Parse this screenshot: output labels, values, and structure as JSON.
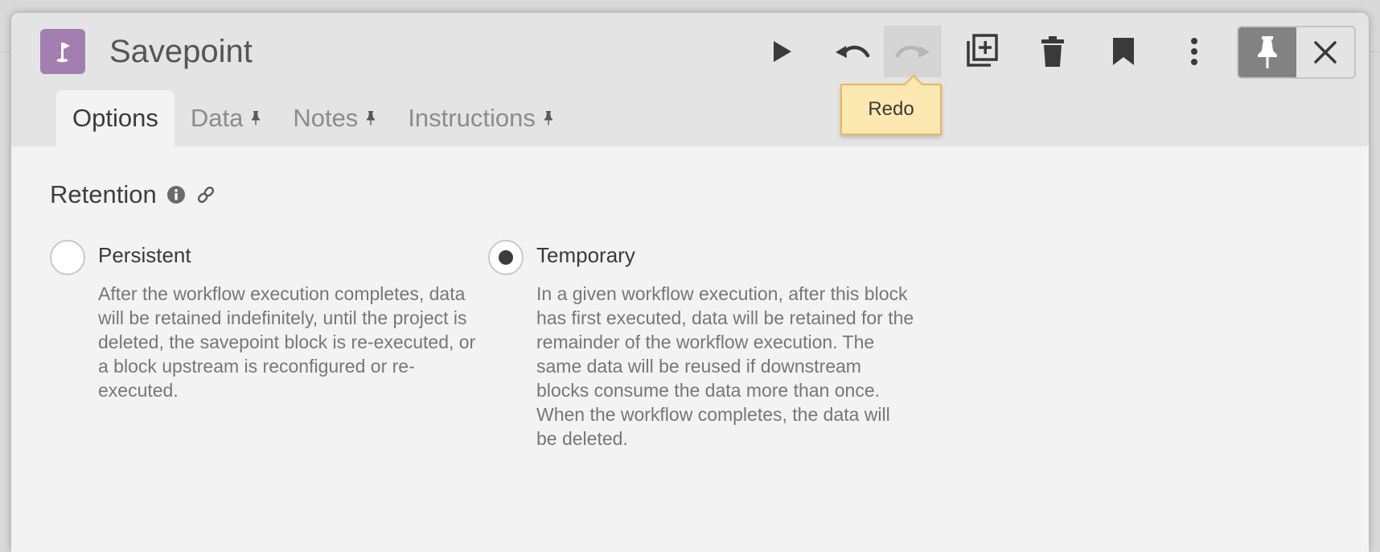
{
  "block": {
    "title": "Savepoint",
    "icon": "flag-icon",
    "icon_color": "#a27fb0"
  },
  "toolbar": {
    "run": "play-icon",
    "undo": "undo-icon",
    "redo": "redo-icon",
    "duplicate": "duplicate-icon",
    "delete": "trash-icon",
    "bookmark": "bookmark-icon",
    "more": "more-vertical-icon",
    "pin": "pin-icon",
    "close": "close-icon"
  },
  "tooltip": {
    "text": "Redo"
  },
  "tabs": [
    {
      "label": "Options",
      "active": true,
      "pin": false
    },
    {
      "label": "Data",
      "active": false,
      "pin": true
    },
    {
      "label": "Notes",
      "active": false,
      "pin": true
    },
    {
      "label": "Instructions",
      "active": false,
      "pin": true
    }
  ],
  "retention": {
    "title": "Retention",
    "options": [
      {
        "label": "Persistent",
        "selected": false,
        "description": "After the workflow execution completes, data will be retained indefinitely, until the project is deleted, the savepoint block is re-executed, or a block upstream is reconfigured or re-executed."
      },
      {
        "label": "Temporary",
        "selected": true,
        "description": "In a given workflow execution, after this block has first executed, data will be retained for the remainder of the workflow execution. The same data will be reused if downstream blocks consume the data more than once. When the workflow completes, the data will be deleted."
      }
    ]
  }
}
